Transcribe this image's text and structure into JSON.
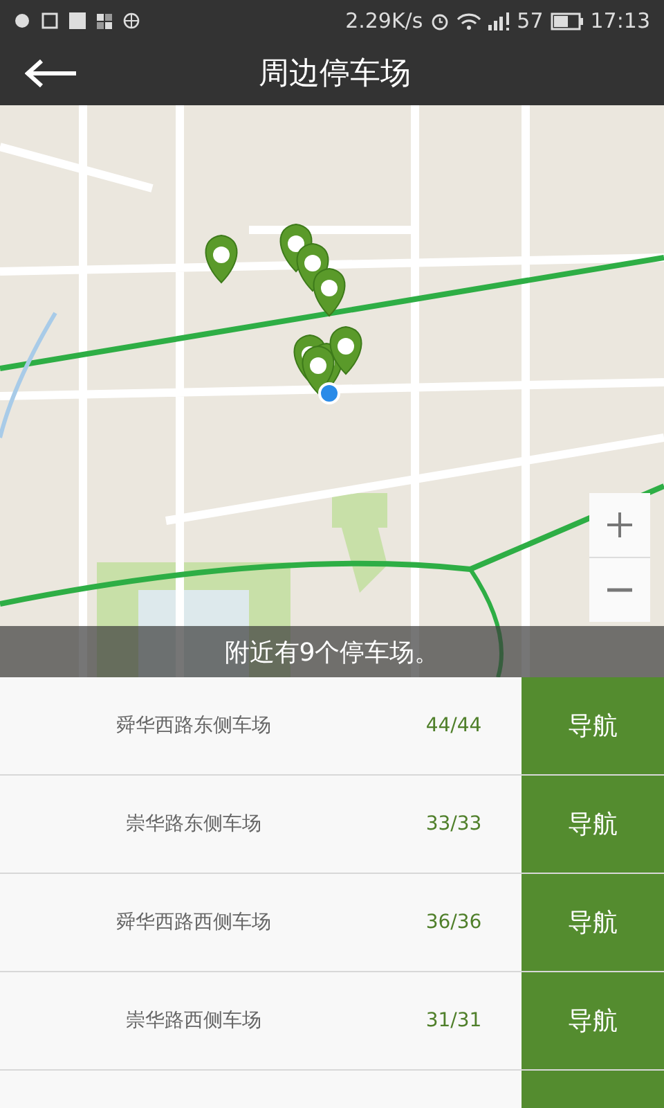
{
  "status_bar": {
    "speed": "2.29K/s",
    "battery_percent": "57",
    "time": "17:13"
  },
  "header": {
    "title": "周边停车场"
  },
  "map": {
    "summary": "附近有9个停车场。"
  },
  "parking_lots": [
    {
      "name": "舜华西路东侧车场",
      "spaces": "44/44",
      "action": "导航"
    },
    {
      "name": "崇华路东侧车场",
      "spaces": "33/33",
      "action": "导航"
    },
    {
      "name": "舜华西路西侧车场",
      "spaces": "36/36",
      "action": "导航"
    },
    {
      "name": "崇华路西侧车场",
      "spaces": "31/31",
      "action": "导航"
    }
  ]
}
